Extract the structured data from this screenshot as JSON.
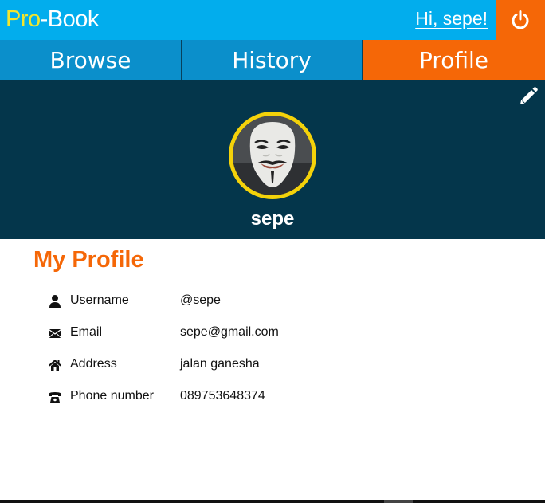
{
  "brand": {
    "pro": "Pro",
    "rest": "-Book"
  },
  "header": {
    "greeting": "Hi, sepe!",
    "power_icon": "power-icon"
  },
  "nav": {
    "tabs": [
      {
        "label": "Browse"
      },
      {
        "label": "History"
      },
      {
        "label": "Profile"
      }
    ],
    "active": "Profile"
  },
  "profile": {
    "display_name": "sepe",
    "edit_icon": "pencil-icon",
    "section_title": "My Profile",
    "fields": [
      {
        "icon": "user-icon",
        "label": "Username",
        "value": "@sepe"
      },
      {
        "icon": "envelope-icon",
        "label": "Email",
        "value": "sepe@gmail.com"
      },
      {
        "icon": "home-icon",
        "label": "Address",
        "value": "jalan ganesha"
      },
      {
        "icon": "phone-icon",
        "label": "Phone number",
        "value": "089753648374"
      }
    ]
  },
  "colors": {
    "topbar": "#02aded",
    "nav": "#0b8fcb",
    "accent": "#f56707",
    "hero": "#04364b",
    "avatar_ring": "#f4d20a",
    "brand_pro": "#f2e52d"
  }
}
